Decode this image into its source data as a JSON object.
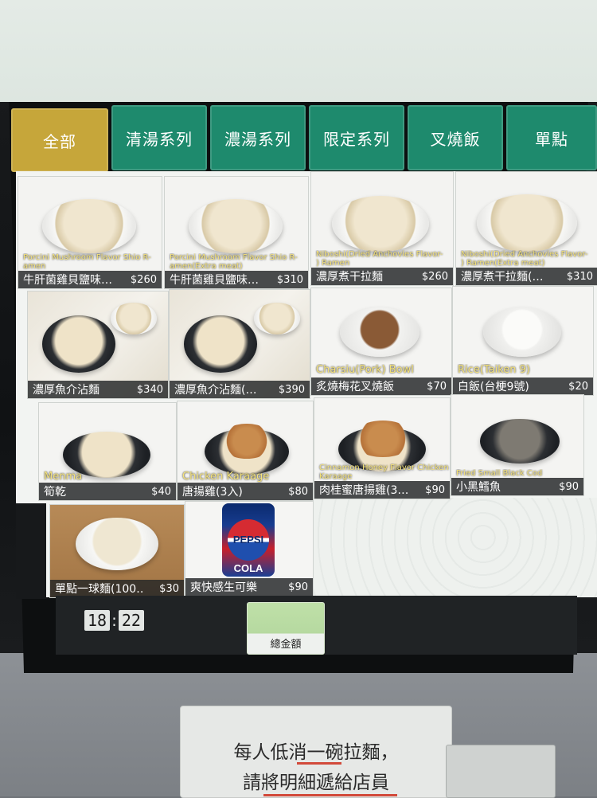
{
  "tabs": [
    {
      "label": "全部",
      "active": true
    },
    {
      "label": "清湯系列",
      "active": false
    },
    {
      "label": "濃湯系列",
      "active": false
    },
    {
      "label": "限定系列",
      "active": false
    },
    {
      "label": "叉燒飯",
      "active": false
    },
    {
      "label": "單點",
      "active": false
    }
  ],
  "menu": [
    {
      "en": "Porcini Mushroom Flavor Shio R-\namen",
      "name": "牛肝菌雞貝鹽味…",
      "price": "$260"
    },
    {
      "en": "Porcini Mushroom Flavor Shio R-\namen(Extra meat)",
      "name": "牛肝菌雞貝鹽味…",
      "price": "$310"
    },
    {
      "en": "Niboshi(Dried Anchovies Flavor-\n) Ramen",
      "name": "濃厚煮干拉麵",
      "price": "$260"
    },
    {
      "en": "Niboshi(Dried Anchovies Flavor-\n) Ramen(Extra meat)",
      "name": "濃厚煮干拉麵(…",
      "price": "$310"
    },
    {
      "en": "",
      "name": "濃厚魚介沾麵",
      "price": "$340"
    },
    {
      "en": "",
      "name": "濃厚魚介沾麵(…",
      "price": "$390"
    },
    {
      "en": "Charsiu(Pork) Bowl",
      "name": "炙燒梅花叉燒飯",
      "price": "$70"
    },
    {
      "en": "Rice(Taiken 9)",
      "name": "白飯(台梗9號)",
      "price": "$20"
    },
    {
      "en": "Menma",
      "name": "筍乾",
      "price": "$40"
    },
    {
      "en": "Chicken Karaage",
      "name": "唐揚雞(3入)",
      "price": "$80"
    },
    {
      "en": "Cinnamon Honey Flavor Chicken\nKaraage",
      "name": "肉桂蜜唐揚雞(3…",
      "price": "$90"
    },
    {
      "en": "Fried Small Black Cod",
      "name": "小黑鱈魚",
      "price": "$90"
    },
    {
      "en": "",
      "name": "單點一球麵(100…",
      "price": "$30"
    },
    {
      "en": "",
      "name": "爽快感生可樂",
      "price": "$90"
    }
  ],
  "footer": {
    "clock_hours": "18",
    "clock_minutes": "22",
    "total_label": "總金額"
  },
  "sign": {
    "line1": "每人低消一碗拉麵，",
    "line2": "請將明細遞給店員"
  },
  "pepsi_can": {
    "brand": "PEPSI",
    "word": "COLA"
  },
  "colors": {
    "tab_green": "#1e8a6d",
    "tab_active": "#c6a63a",
    "price_bar": "#222426",
    "en_caption": "#f4e27a"
  }
}
